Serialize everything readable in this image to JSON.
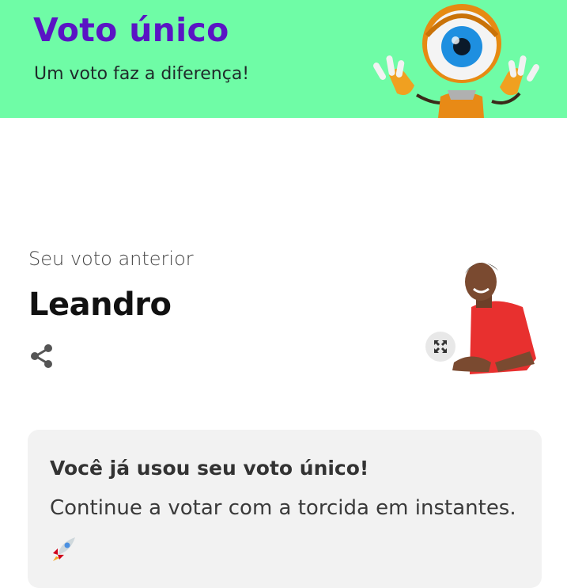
{
  "banner": {
    "title": "Voto único",
    "subtitle": "Um voto faz a diferença!",
    "bg_color": "#6ffca6",
    "title_color": "#5a14c4",
    "mascot_icon": "big-brother-eye-mascot"
  },
  "previous_vote": {
    "label": "Seu voto anterior",
    "name": "Leandro",
    "share_icon": "share-icon",
    "expand_icon": "expand-icon"
  },
  "notice_card": {
    "title": "Você já usou seu voto único!",
    "text": "Continue a votar com a torcida em instantes.",
    "emoji_icon": "rocket-icon"
  }
}
